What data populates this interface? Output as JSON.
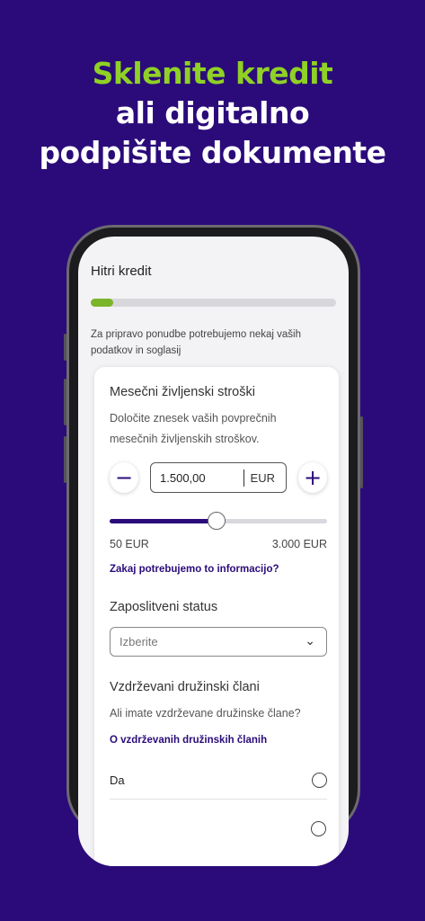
{
  "headline": {
    "line1": "Sklenite kredit",
    "line2": "ali digitalno",
    "line3": "podpišite dokumente"
  },
  "app": {
    "title": "Hitri kredit",
    "progress": 0.09,
    "intro": "Za pripravo ponudbe potrebujemo nekaj vaših podatkov in soglasij"
  },
  "living_costs": {
    "title": "Mesečni življenski stroški",
    "description": "Določite znesek vaših povprečnih mesečnih življenskih stroškov.",
    "minus_icon": "minus-icon",
    "plus_icon": "plus-icon",
    "amount_value": "1.500,00",
    "currency": "EUR",
    "slider_value": 1500,
    "slider_min": 50,
    "slider_max": 3000,
    "min_label": "50 EUR",
    "max_label": "3.000 EUR",
    "info_link": "Zakaj potrebujemo to informacijo?"
  },
  "employment": {
    "title": "Zaposlitveni status",
    "placeholder": "Izberite",
    "chevron_icon": "chevron-down-icon"
  },
  "dependents": {
    "title": "Vzdrževani družinski člani",
    "question": "Ali imate vzdrževane družinske člane?",
    "info_link": "O vzdrževanih družinskih članih",
    "option_yes": "Da"
  },
  "colors": {
    "background": "#2b0b7a",
    "accent_green": "#8fd125",
    "brand_purple": "#2b0b7a"
  }
}
